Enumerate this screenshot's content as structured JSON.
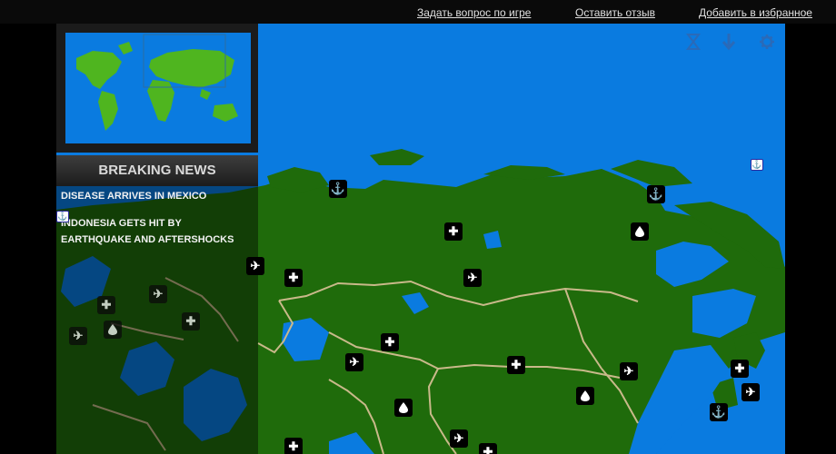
{
  "top_links": {
    "ask_question": "Задать вопрос по игре",
    "leave_review": "Оставить отзыв",
    "add_favorites": "Добавить в избранное"
  },
  "news": {
    "header": "BREAKING NEWS",
    "items": [
      "DISEASE ARRIVES IN MEXICO",
      "INDONESIA GETS HIT BY EARTHQUAKE AND AFTERSHOCKS"
    ]
  },
  "controls": [
    "hourglass-icon",
    "download-arrow-icon",
    "gear-icon"
  ],
  "colors": {
    "ocean": "#0a7be0",
    "land": "#1f6b0b",
    "border": "#c9b98a",
    "minimap_land": "#4fb51f"
  }
}
